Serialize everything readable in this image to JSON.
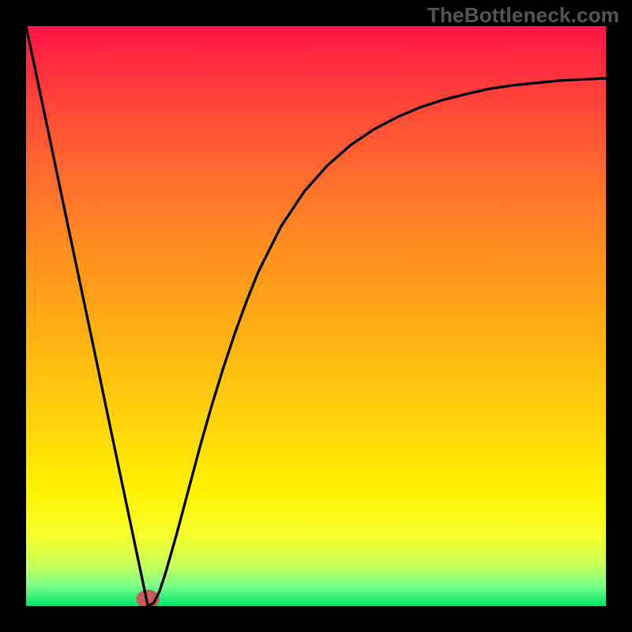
{
  "watermark": "TheBottleneck.com",
  "chart_data": {
    "type": "line",
    "title": "",
    "xlabel": "",
    "ylabel": "",
    "xlim": [
      0,
      100
    ],
    "ylim": [
      0,
      100
    ],
    "grid": false,
    "series": [
      {
        "name": "curve",
        "color": "#000000",
        "x": [
          0,
          2,
          4,
          6,
          8,
          10,
          12,
          14,
          16,
          18,
          20,
          21,
          22,
          23,
          24,
          26,
          28,
          30,
          32,
          34,
          36,
          38,
          40,
          44,
          48,
          52,
          56,
          60,
          64,
          68,
          72,
          76,
          80,
          84,
          88,
          92,
          96,
          100
        ],
        "y": [
          100.0,
          90.5,
          81.0,
          71.4,
          61.9,
          52.4,
          42.9,
          33.3,
          23.8,
          14.3,
          4.8,
          0.0,
          0.5,
          2.5,
          5.5,
          12.5,
          20.0,
          27.5,
          34.5,
          41.0,
          47.0,
          52.5,
          57.5,
          65.5,
          71.5,
          76.0,
          79.5,
          82.2,
          84.3,
          86.0,
          87.3,
          88.3,
          89.2,
          89.8,
          90.2,
          90.6,
          90.8,
          91.0
        ]
      }
    ],
    "background_gradient": {
      "stops": [
        {
          "offset": 0.0,
          "color": "#ff1445"
        },
        {
          "offset": 0.1,
          "color": "#ff3a3c"
        },
        {
          "offset": 0.25,
          "color": "#ff6a2f"
        },
        {
          "offset": 0.4,
          "color": "#ff921f"
        },
        {
          "offset": 0.55,
          "color": "#ffb512"
        },
        {
          "offset": 0.7,
          "color": "#ffd80a"
        },
        {
          "offset": 0.8,
          "color": "#fff200"
        },
        {
          "offset": 0.88,
          "color": "#f5ff2e"
        },
        {
          "offset": 0.93,
          "color": "#c8ff5a"
        },
        {
          "offset": 0.965,
          "color": "#7dff88"
        },
        {
          "offset": 1.0,
          "color": "#00e66e"
        }
      ]
    },
    "marker": {
      "x": 21,
      "y": 1.2,
      "rx": 2.0,
      "ry": 1.6,
      "fill": "#cc5a5a"
    }
  }
}
